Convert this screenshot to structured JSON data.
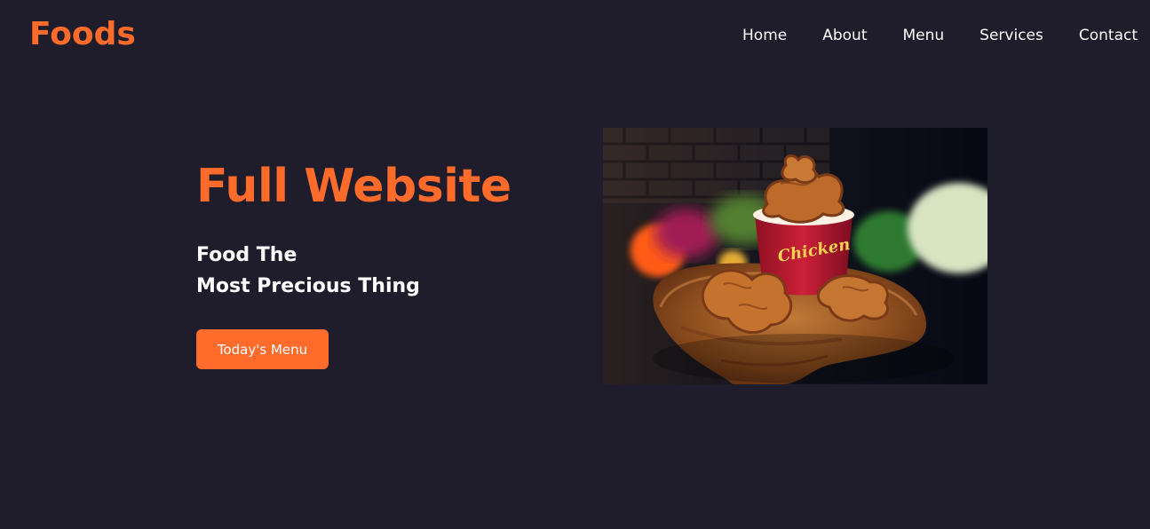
{
  "brand": {
    "name": "Foods",
    "accent_color": "#ff6b2b",
    "background_color": "#1f1c2b"
  },
  "nav": {
    "items": [
      {
        "label": "Home"
      },
      {
        "label": "About"
      },
      {
        "label": "Menu"
      },
      {
        "label": "Services"
      },
      {
        "label": "Contact"
      }
    ]
  },
  "hero": {
    "title": "Full Website",
    "subtitle_line_1": "Food The",
    "subtitle_line_2": "Most Precious Thing",
    "button_label": "Today's Menu",
    "image": {
      "subject": "fried chicken in a red bucket on a wooden serving board",
      "bucket_text": "Chicken"
    }
  }
}
